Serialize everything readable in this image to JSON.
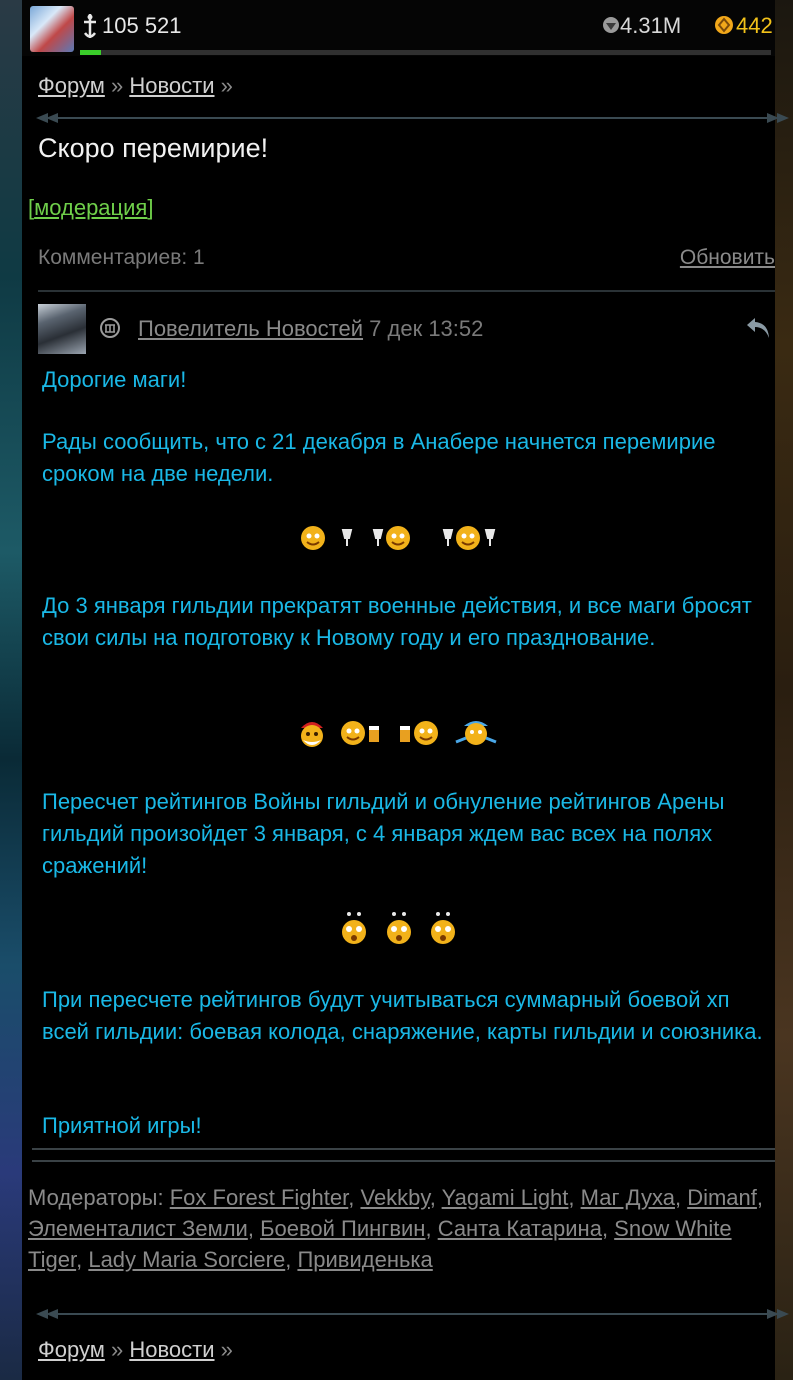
{
  "header": {
    "power": "105 521",
    "silver": "4.31M",
    "gold": "442",
    "energy_fraction": 0.03
  },
  "breadcrumb": {
    "forum": "Форум",
    "sep": "»",
    "news": "Новости"
  },
  "thread": {
    "title": "Скоро перемирие!",
    "moderation_open": "[",
    "moderation_label": "модерация",
    "moderation_close": "]",
    "comments_count": "Комментариев: 1",
    "refresh": "Обновить"
  },
  "post": {
    "author": "Повелитель Новостей",
    "date": "7 дек 13:52",
    "paragraphs": [
      "Дорогие маги!",
      "Рады сообщить, что с 21 декабря в Анабере начнется перемирие сроком на две недели.",
      "До 3 января гильдии прекратят военные действия, и все маги бросят свои силы на подготовку к Новому году и его празднование.",
      "Пересчет рейтингов Войны гильдий и обнуление рейтингов Арены гильдий произойдет 3 января, с 4 января ждем вас всех на полях сражений!",
      "При пересчете рейтингов будут учитываться суммарный боевой хп всей гильдии: боевая колода, снаряжение, карты гильдии и союзника.",
      "Приятной игры!"
    ],
    "smiley_rows": [
      [
        "drinking-smiley-icon",
        "drinking-smiley-icon",
        "drinking-smiley-icon"
      ],
      [
        "santa-smiley-icon",
        "beer-smiley-icon",
        "beer-smiley-icon",
        "dancing-smiley-icon"
      ],
      [
        "surprised-smiley-icon",
        "surprised-smiley-icon",
        "surprised-smiley-icon"
      ]
    ]
  },
  "moderators": {
    "label": "Модераторы:",
    "names": [
      "Fox Forest Fighter",
      "Vekkby",
      "Yagami Light",
      "Маг Духа",
      "Dimanf",
      "Элементалист Земли",
      "Боевой Пингвин",
      "Санта Катарина",
      "Snow White Tiger",
      "Lady Maria Sorciere",
      "Привиденька"
    ]
  },
  "colors": {
    "post_text": "#1ab8e6",
    "moderation": "#6fcf4a",
    "gold": "#f2c21a",
    "energy_bar": "#3acd2a"
  }
}
